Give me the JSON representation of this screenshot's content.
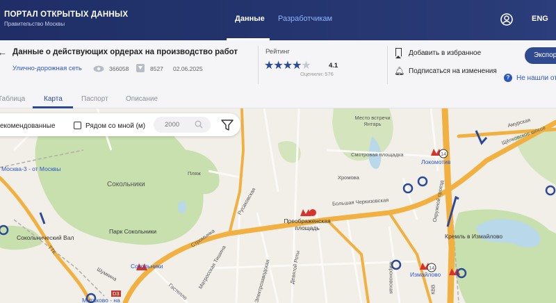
{
  "header": {
    "brand_title": "ПОРТАЛ ОТКРЫТЫХ ДАННЫХ",
    "brand_subtitle": "Правительство Москвы",
    "nav": [
      "Данные",
      "Разработчикам"
    ],
    "active_nav": "Данные",
    "lang": "ENG",
    "user_icon": "user-circle-icon"
  },
  "dataset": {
    "title": "Данные о действующих ордерах на производство работ",
    "category": "Улично-дорожная сеть",
    "views": "366058",
    "downloads": "8527",
    "date": "02.06.2025"
  },
  "rating": {
    "label": "Рейтинг",
    "value": "4.1",
    "stars_filled": 4,
    "stars_total": 5,
    "count_text": "Оценили: 576"
  },
  "actions": {
    "favorite": "Добавить в избранное",
    "subscribe": "Подписаться на изменения",
    "export": "Экспорт",
    "help": "Не нашли от"
  },
  "tabs": [
    "Таблица",
    "Карта",
    "Паспорт",
    "Описание"
  ],
  "active_tab": "Карта",
  "map_filters": {
    "recommended": "екомендованные",
    "nearby": "Рядом со мной (м)",
    "radius_placeholder": "2000"
  },
  "map_labels": {
    "sokolniki": "Сокольники",
    "park": "Парк Сокольники",
    "plyazh": "Пляж",
    "moskva3": "Москва-3 - от Москвы",
    "sokolnicheskiy_val": "Сокольнический Вал",
    "metro_sokolniki": "Сокольники",
    "mitkovo": "Митьково - на",
    "stromynka": "Стромынка",
    "rusakovskaya": "Русаковская",
    "bolshaya_cherkizovskaya": "Большая Черкизовская",
    "preobrazhenskaya": "Преображенская площадь",
    "khromova": "Хромова",
    "smotrovaya": "Смотровая площадка",
    "mesto_vstrechi": "Место встречи Янтарь",
    "lokomotiv": "Локомотив",
    "izmaylovo": "Измайлово",
    "kreml": "Кремль в Измайлово",
    "mironovskaya": "Мироновская",
    "devyatoy_roty": "Девятой Роты",
    "elektrozavodskaya": "Электрозаводская",
    "matrosskaya": "Матросская Тишина",
    "shumkina": "Шумкина",
    "gastello": "Гастелло",
    "ttk": "ТТК",
    "okruzhnoy": "Окружной проезд",
    "amurskaya": "Амурская",
    "d_label": "D3",
    "ring_14a": "14",
    "ring_14b": "14",
    "kvv": "КВВ",
    "shchelkovskoe": "Щёлковское шоссе"
  },
  "colors": {
    "header_bg": "#1f2e66",
    "accent_blue": "#2a4a99",
    "link_blue": "#2b57c6",
    "road_orange": "#f2b041",
    "park_green": "#c8dfae",
    "map_base": "#f1efe8",
    "marker_blue": "#2a4a99",
    "metro_red": "#d9322c"
  }
}
